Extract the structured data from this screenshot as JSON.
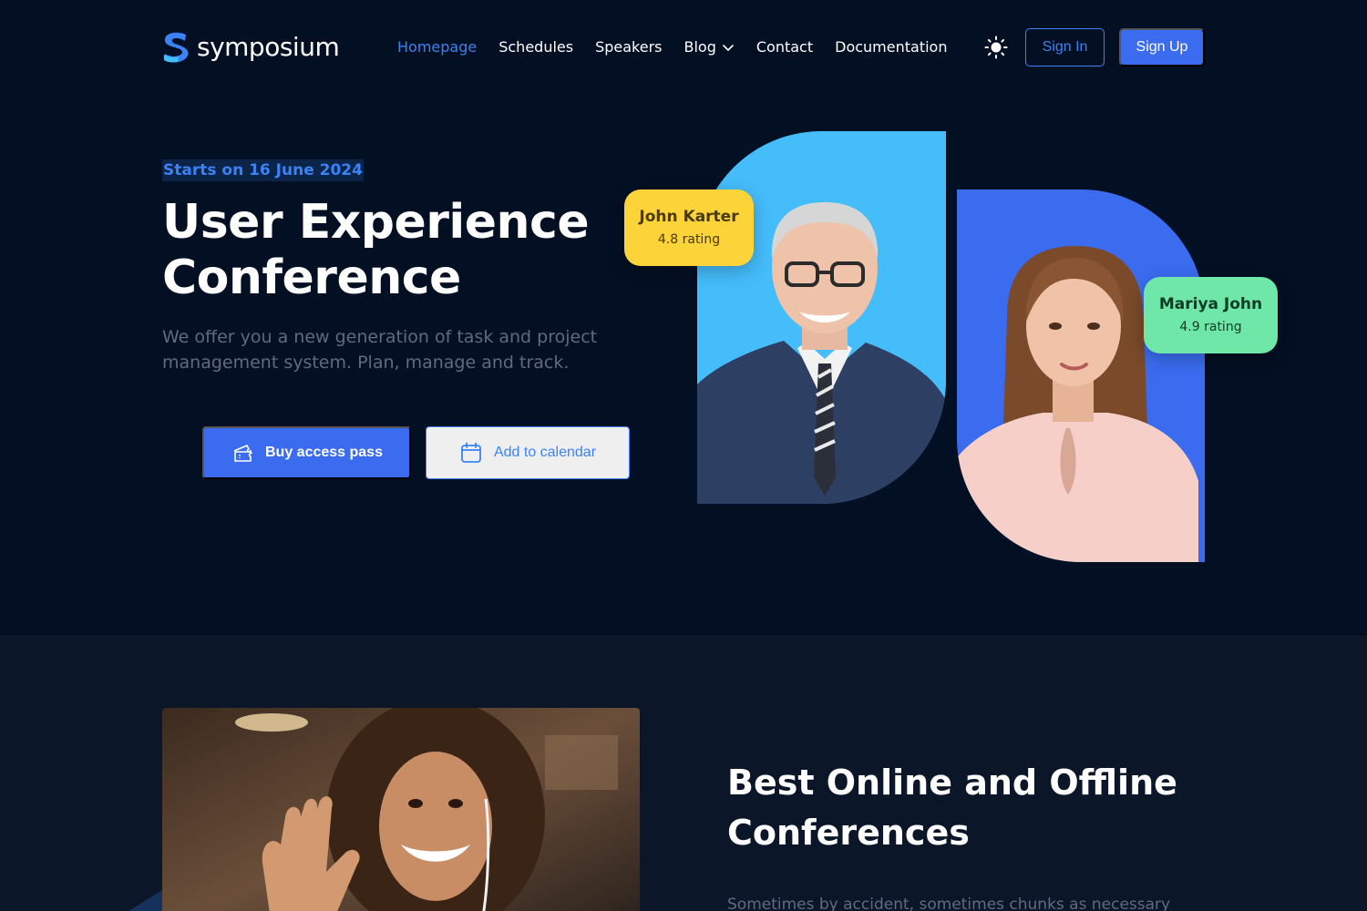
{
  "brand": {
    "name": "symposium"
  },
  "nav": {
    "items": [
      {
        "label": "Homepage",
        "active": true
      },
      {
        "label": "Schedules",
        "active": false
      },
      {
        "label": "Speakers",
        "active": false
      },
      {
        "label": "Blog",
        "active": false,
        "has_dropdown": true
      },
      {
        "label": "Contact",
        "active": false
      },
      {
        "label": "Documentation",
        "active": false
      }
    ],
    "theme_icon": "sun-icon",
    "sign_in": "Sign In",
    "sign_up": "Sign Up"
  },
  "hero": {
    "tag": "Starts on 16 June 2024",
    "title_line1": "User Experience",
    "title_line2": "Conference",
    "description": "We offer you a new generation of task and project management system. Plan, manage and track.",
    "buy_label": "Buy access pass",
    "buy_icon": "ticket-icon",
    "calendar_label": "Add to calendar",
    "calendar_icon": "calendar-icon"
  },
  "speakers": [
    {
      "name": "John Karter",
      "rating": "4.8 rating",
      "badge_color": "#fcd43a",
      "card_color": "#45bdfb"
    },
    {
      "name": "Mariya John",
      "rating": "4.9 rating",
      "badge_color": "#6ee7a8",
      "card_color": "#3b6cf0"
    }
  ],
  "section2": {
    "title": "Best Online and Offline Conferences",
    "text": "Sometimes by accident, sometimes chunks as necessary"
  },
  "colors": {
    "background": "#030f22",
    "section_background": "#0c1629",
    "accent": "#3b82f6",
    "button": "#3b6cf0"
  }
}
